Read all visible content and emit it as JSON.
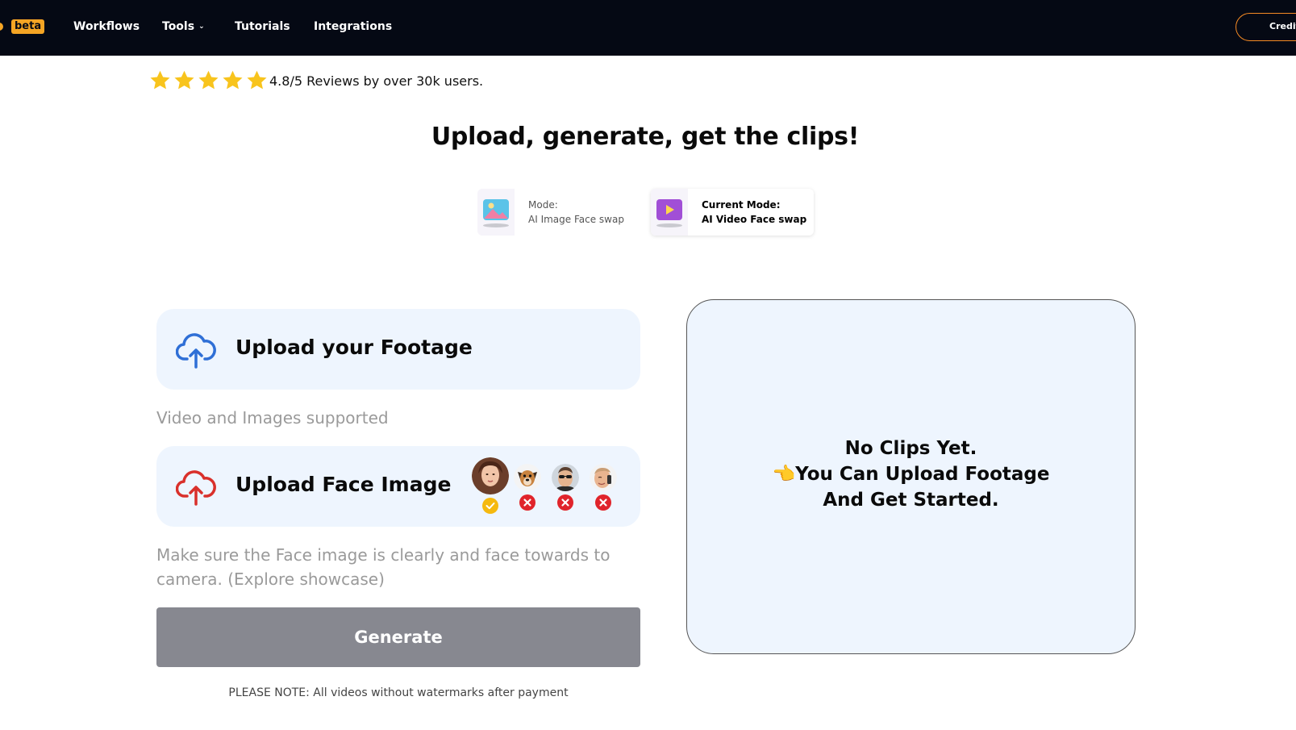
{
  "nav": {
    "beta_label": "beta",
    "links": [
      "Workflows",
      "Tools",
      "Tutorials",
      "Integrations"
    ],
    "credits_label": "Credits",
    "accent": "#f5a524",
    "background": "#050914"
  },
  "reviews": {
    "stars": 5,
    "rating_text": "4.8/5 Reviews by over 30k users."
  },
  "headline": "Upload, generate, get the clips!",
  "modes": [
    {
      "line1": "Mode:",
      "line2": "AI Image Face swap",
      "active": false
    },
    {
      "line1": "Current Mode:",
      "line2": "AI Video Face swap",
      "active": true
    }
  ],
  "footage_upload": {
    "label": "Upload your Footage",
    "hint": "Video and Images supported",
    "icon": "cloud-upload-icon",
    "icon_color": "#2f6fd6"
  },
  "face_upload": {
    "label": "Upload Face Image",
    "hint": "Make sure the Face image is clearly and face towards to camera. (Explore showcase)",
    "icon": "cloud-upload-icon",
    "icon_color": "#d9302b",
    "examples": [
      {
        "subject": "woman-face",
        "valid": true
      },
      {
        "subject": "dog",
        "valid": false
      },
      {
        "subject": "man-with-sunglasses",
        "valid": false
      },
      {
        "subject": "man-on-phone",
        "valid": false
      }
    ]
  },
  "generate_label": "Generate",
  "note": "PLEASE NOTE: All videos without watermarks after payment",
  "preview": {
    "line1": "No Clips Yet.",
    "line2": "👈You Can Upload Footage",
    "line3": "And Get Started."
  }
}
